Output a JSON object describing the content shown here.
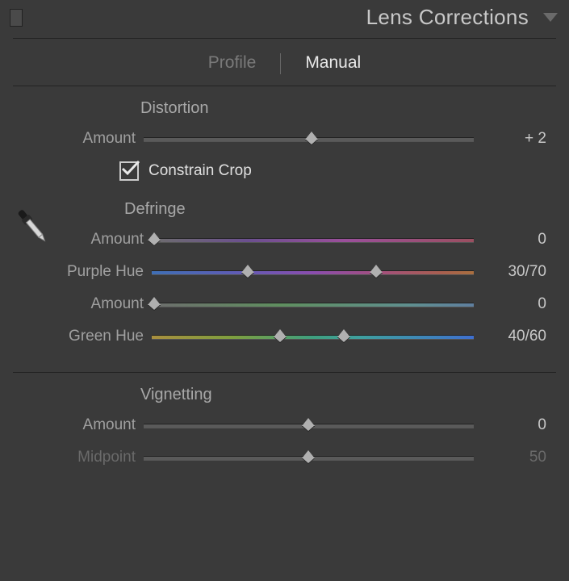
{
  "panel": {
    "title": "Lens Corrections"
  },
  "tabs": {
    "profile": "Profile",
    "manual": "Manual",
    "active": "manual"
  },
  "distortion": {
    "title": "Distortion",
    "amount_label": "Amount",
    "amount_value": "+ 2",
    "constrain_crop_label": "Constrain Crop",
    "constrain_crop_checked": true
  },
  "defringe": {
    "title": "Defringe",
    "purple_amount_label": "Amount",
    "purple_amount_value": "0",
    "purple_hue_label": "Purple Hue",
    "purple_hue_value": "30/70",
    "green_amount_label": "Amount",
    "green_amount_value": "0",
    "green_hue_label": "Green Hue",
    "green_hue_value": "40/60"
  },
  "vignetting": {
    "title": "Vignetting",
    "amount_label": "Amount",
    "amount_value": "0",
    "midpoint_label": "Midpoint",
    "midpoint_value": "50"
  }
}
